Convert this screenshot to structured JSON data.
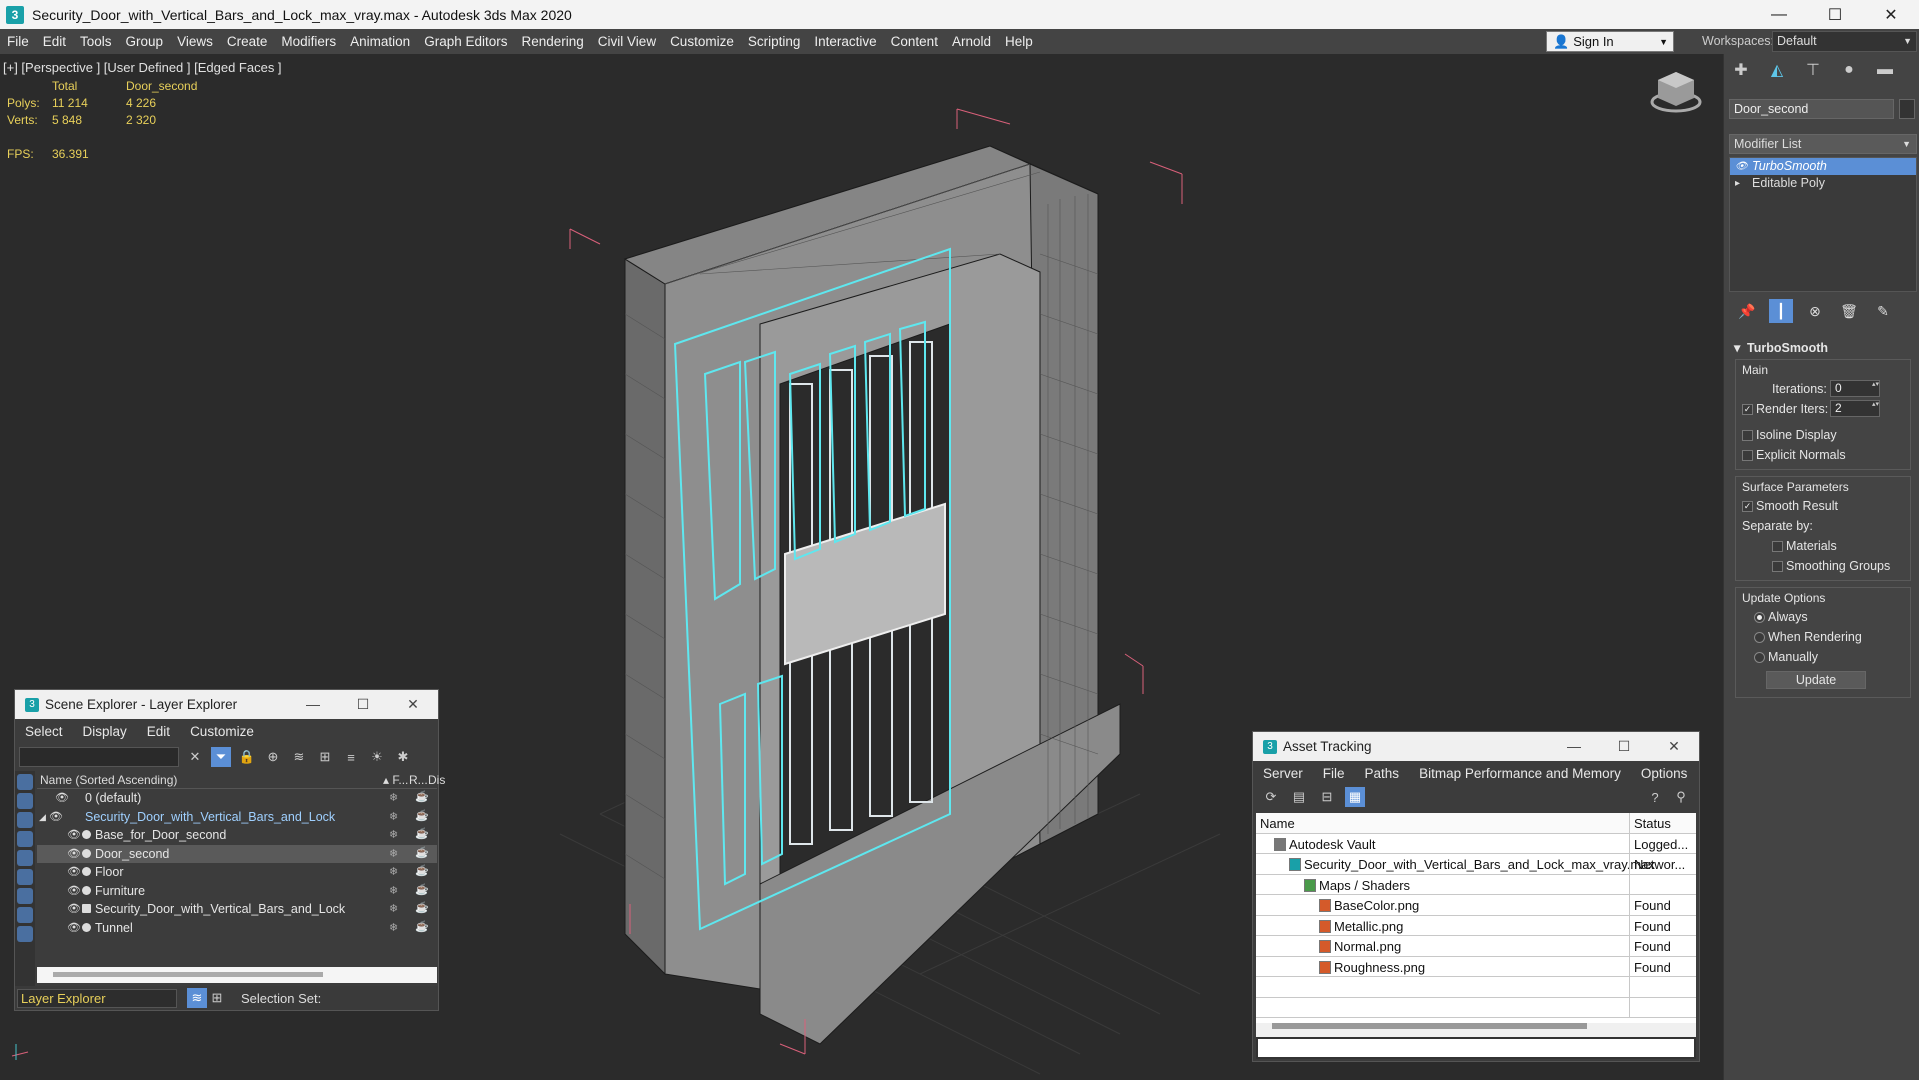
{
  "window": {
    "title": "Security_Door_with_Vertical_Bars_and_Lock_max_vray.max - Autodesk 3ds Max 2020"
  },
  "menu": [
    "File",
    "Edit",
    "Tools",
    "Group",
    "Views",
    "Create",
    "Modifiers",
    "Animation",
    "Graph Editors",
    "Rendering",
    "Civil View",
    "Customize",
    "Scripting",
    "Interactive",
    "Content",
    "Arnold",
    "Help"
  ],
  "signin": {
    "label": "Sign In"
  },
  "workspaces": {
    "label": "Workspaces:",
    "value": "Default"
  },
  "viewport": {
    "label": "[+] [Perspective ] [User Defined ] [Edged Faces ]",
    "stats": {
      "col_total": "Total",
      "col_object": "Door_second",
      "polys_label": "Polys:",
      "polys_total": "11 214",
      "polys_obj": "4 226",
      "verts_label": "Verts:",
      "verts_total": "5 848",
      "verts_obj": "2 320",
      "fps_label": "FPS:",
      "fps_value": "36.391"
    }
  },
  "scene_explorer": {
    "title": "Scene Explorer - Layer Explorer",
    "menu": [
      "Select",
      "Display",
      "Edit",
      "Customize"
    ],
    "columns": {
      "name": "Name (Sorted Ascending)",
      "c1": "▴ F...",
      "c2": "R...",
      "c3": "Dis"
    },
    "rows": [
      {
        "name": "0 (default)"
      },
      {
        "name": "Security_Door_with_Vertical_Bars_and_Lock"
      },
      {
        "name": "Base_for_Door_second"
      },
      {
        "name": "Door_second"
      },
      {
        "name": "Floor"
      },
      {
        "name": "Furniture"
      },
      {
        "name": "Security_Door_with_Vertical_Bars_and_Lock"
      },
      {
        "name": "Tunnel"
      }
    ],
    "footer_select": "Layer Explorer",
    "selection_set": "Selection Set:"
  },
  "asset_tracking": {
    "title": "Asset Tracking",
    "menu": [
      "Server",
      "File",
      "Paths",
      "Bitmap Performance and Memory",
      "Options"
    ],
    "columns": {
      "name": "Name",
      "status": "Status"
    },
    "rows": [
      {
        "name": "Autodesk Vault",
        "status": "Logged..."
      },
      {
        "name": "Security_Door_with_Vertical_Bars_and_Lock_max_vray.max",
        "status": "Networ..."
      },
      {
        "name": "Maps / Shaders",
        "status": ""
      },
      {
        "name": "BaseColor.png",
        "status": "Found"
      },
      {
        "name": "Metallic.png",
        "status": "Found"
      },
      {
        "name": "Normal.png",
        "status": "Found"
      },
      {
        "name": "Roughness.png",
        "status": "Found"
      }
    ]
  },
  "command_panel": {
    "object_name": "Door_second",
    "modifier_list": "Modifier List",
    "stack": [
      "TurboSmooth",
      "Editable Poly"
    ],
    "turbosmooth": {
      "title": "TurboSmooth",
      "main": "Main",
      "iterations_label": "Iterations:",
      "iterations": "0",
      "render_iters_label": "Render Iters:",
      "render_iters": "2",
      "isoline": "Isoline Display",
      "explicit": "Explicit Normals",
      "surface": "Surface Parameters",
      "smooth_result": "Smooth Result",
      "separate_by": "Separate by:",
      "materials": "Materials",
      "smoothing_groups": "Smoothing Groups",
      "update_options": "Update Options",
      "always": "Always",
      "when_rendering": "When Rendering",
      "manually": "Manually",
      "update": "Update"
    }
  }
}
